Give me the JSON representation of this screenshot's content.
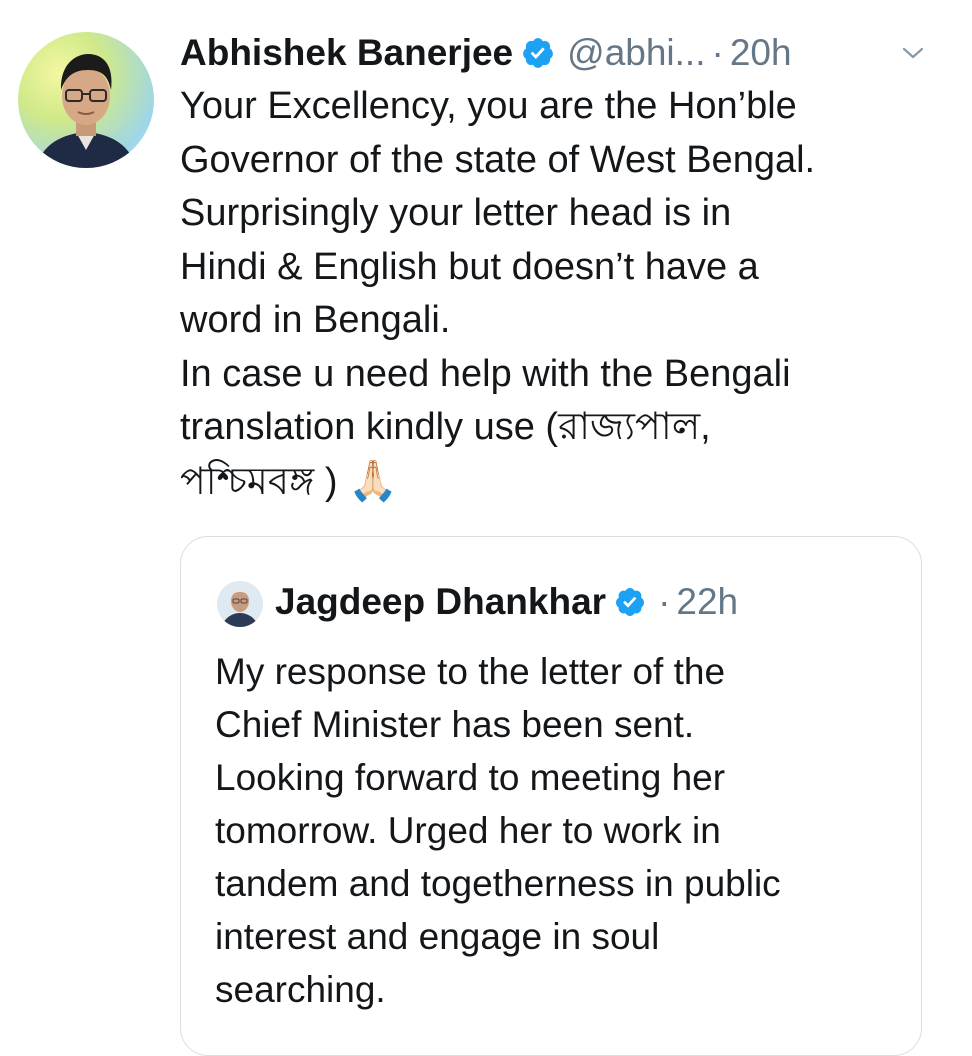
{
  "tweet": {
    "author_name": "Abhishek Banerjee",
    "handle": "@abhi...",
    "separator": "·",
    "time": "20h",
    "lines": [
      "Your Excellency, you are the Hon’ble",
      "Governor of the state of West Bengal.",
      "Surprisingly your letter head is in",
      "Hindi & English but doesn’t have a",
      "word in Bengali.",
      "In case u need help with the Bengali",
      "translation kindly use (রাজ্যপাল,",
      "পশ্চিমবঙ্গ )"
    ],
    "emoji": "🙏🏻"
  },
  "quoted_tweet": {
    "author_name": "Jagdeep Dhankhar",
    "separator": "·",
    "time": "22h",
    "lines": [
      "My response to the letter of the",
      "Chief Minister has been sent.",
      "Looking forward to meeting her",
      "tomorrow. Urged her to work in",
      "tandem and togetherness in public",
      "interest and engage in soul",
      "searching."
    ]
  },
  "icons": {
    "verified": "verified-badge-icon",
    "caret": "chevron-down-icon"
  },
  "colors": {
    "verified_blue": "#1da1f2",
    "text_primary": "#14171a",
    "text_secondary": "#657786",
    "border": "#d8dee3"
  }
}
